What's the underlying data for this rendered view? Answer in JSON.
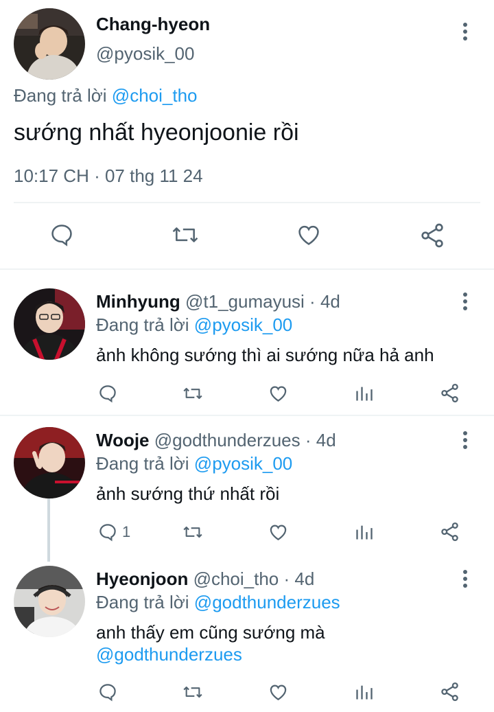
{
  "main_tweet": {
    "display_name": "Chang-hyeon",
    "handle": "@pyosik_00",
    "reply_prefix": "Đang trả lời",
    "reply_to": "@choi_tho",
    "text": "sướng nhất hyeonjoonie rồi",
    "timestamp": "10:17 CH · 07 thg 11 24"
  },
  "replies": [
    {
      "display_name": "Minhyung",
      "handle": "@t1_gumayusi",
      "sep": "·",
      "age": "4d",
      "reply_prefix": "Đang trả lời",
      "reply_to": "@pyosik_00",
      "text": "ảnh không sướng thì ai sướng nữa hả anh",
      "reply_count": ""
    },
    {
      "display_name": "Wooje",
      "handle": "@godthunderzues",
      "sep": "·",
      "age": "4d",
      "reply_prefix": "Đang trả lời",
      "reply_to": "@pyosik_00",
      "text": "ảnh sướng thứ nhất rồi",
      "reply_count": "1"
    },
    {
      "display_name": "Hyeonjoon",
      "handle": "@choi_tho",
      "sep": "·",
      "age": "4d",
      "reply_prefix": "Đang trả lời",
      "reply_to": "@godthunderzues",
      "text": "anh thấy em cũng sướng mà",
      "mention": "@godthunderzues",
      "reply_count": ""
    }
  ],
  "colors": {
    "link": "#1d9bf0",
    "secondary": "#536471",
    "divider": "#eff3f4"
  }
}
